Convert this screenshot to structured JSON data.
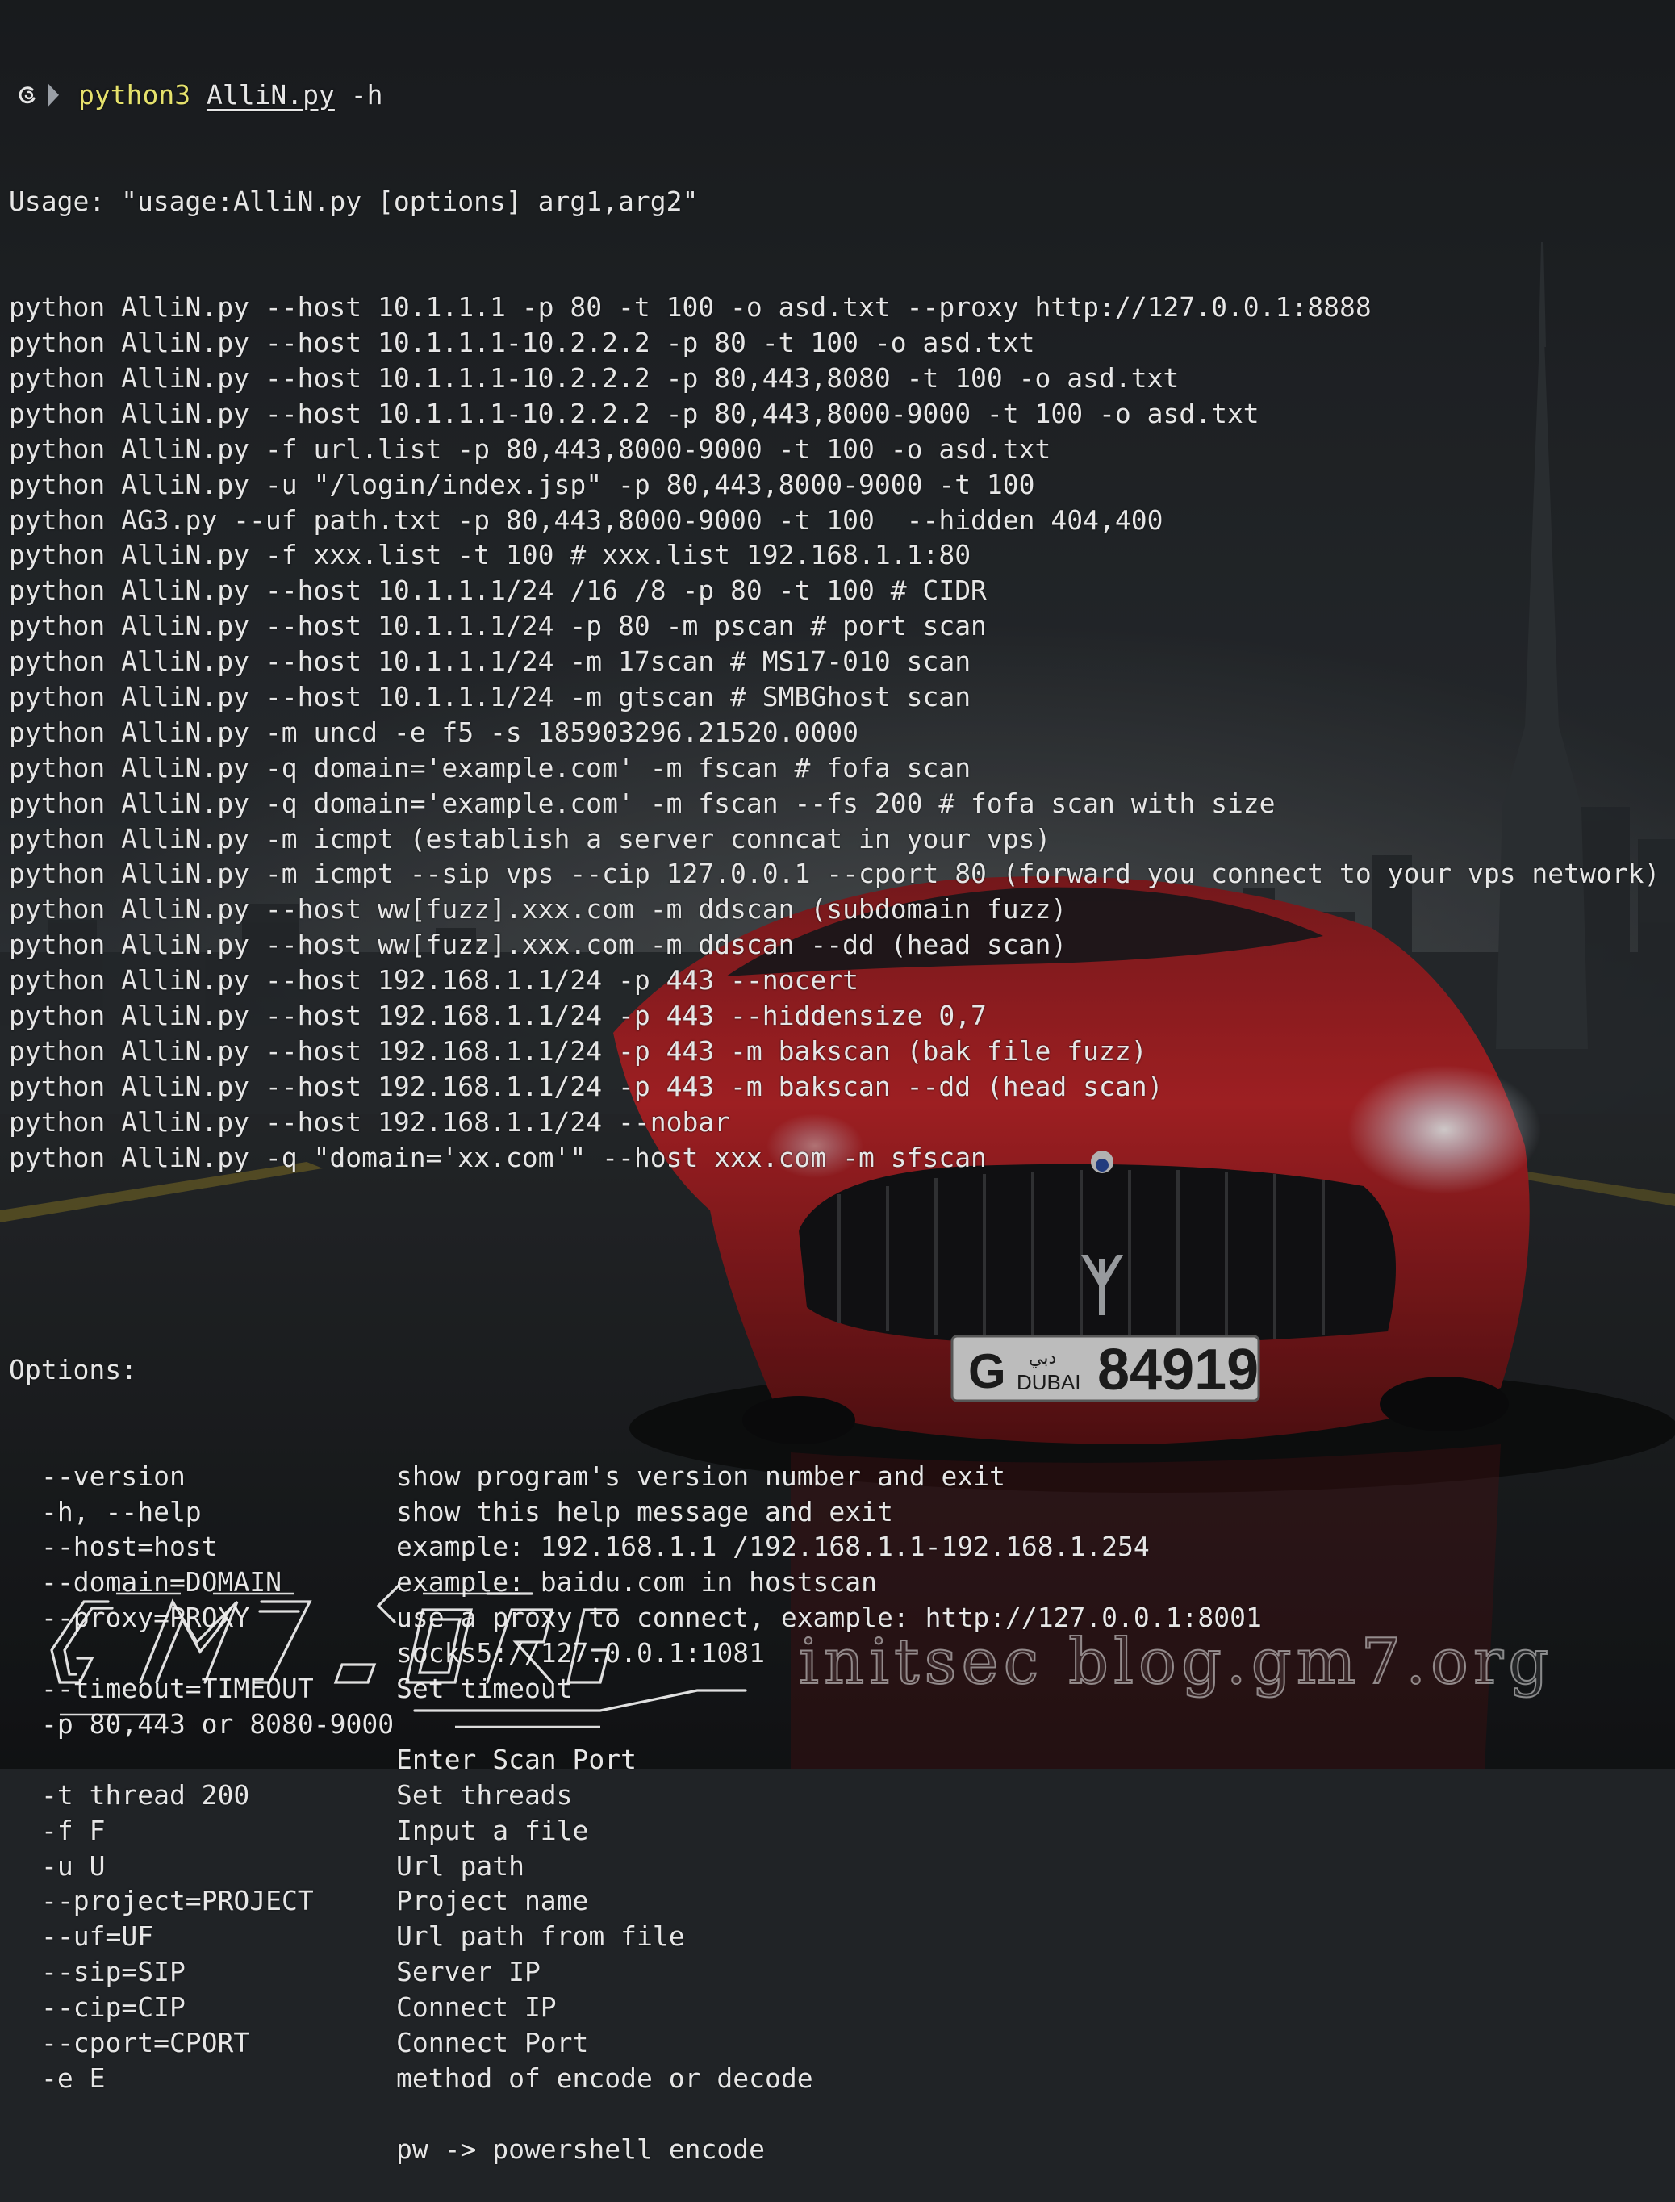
{
  "prompt": {
    "icon": "debian-swirl-icon",
    "command": "python3",
    "script": "AlliN.py",
    "args": "-h"
  },
  "usage_line": "Usage: \"usage:AlliN.py [options] arg1,arg2\"",
  "examples": [
    "python AlliN.py --host 10.1.1.1 -p 80 -t 100 -o asd.txt --proxy http://127.0.0.1:8888",
    "python AlliN.py --host 10.1.1.1-10.2.2.2 -p 80 -t 100 -o asd.txt",
    "python AlliN.py --host 10.1.1.1-10.2.2.2 -p 80,443,8080 -t 100 -o asd.txt",
    "python AlliN.py --host 10.1.1.1-10.2.2.2 -p 80,443,8000-9000 -t 100 -o asd.txt",
    "python AlliN.py -f url.list -p 80,443,8000-9000 -t 100 -o asd.txt",
    "python AlliN.py -u \"/login/index.jsp\" -p 80,443,8000-9000 -t 100",
    "python AG3.py --uf path.txt -p 80,443,8000-9000 -t 100  --hidden 404,400",
    "python AlliN.py -f xxx.list -t 100 # xxx.list 192.168.1.1:80",
    "python AlliN.py --host 10.1.1.1/24 /16 /8 -p 80 -t 100 # CIDR",
    "python AlliN.py --host 10.1.1.1/24 -p 80 -m pscan # port scan",
    "python AlliN.py --host 10.1.1.1/24 -m 17scan # MS17-010 scan",
    "python AlliN.py --host 10.1.1.1/24 -m gtscan # SMBGhost scan",
    "python AlliN.py -m uncd -e f5 -s 185903296.21520.0000",
    "python AlliN.py -q domain='example.com' -m fscan # fofa scan",
    "python AlliN.py -q domain='example.com' -m fscan --fs 200 # fofa scan with size",
    "python AlliN.py -m icmpt (establish a server conncat in your vps)",
    "python AlliN.py -m icmpt --sip vps --cip 127.0.0.1 --cport 80 (forward you connect to your vps network)",
    "python AlliN.py --host ww[fuzz].xxx.com -m ddscan (subdomain fuzz)",
    "python AlliN.py --host ww[fuzz].xxx.com -m ddscan --dd (head scan)",
    "python AlliN.py --host 192.168.1.1/24 -p 443 --nocert",
    "python AlliN.py --host 192.168.1.1/24 -p 443 --hiddensize 0,7",
    "python AlliN.py --host 192.168.1.1/24 -p 443 -m bakscan (bak file fuzz)",
    "python AlliN.py --host 192.168.1.1/24 -p 443 -m bakscan --dd (head scan)",
    "python AlliN.py --host 192.168.1.1/24 --nobar",
    "python AlliN.py -q \"domain='xx.com'\" --host xxx.com -m sfscan"
  ],
  "options_header": "Options:",
  "options": [
    {
      "name": "--version",
      "desc": "show program's version number and exit"
    },
    {
      "name": "-h, --help",
      "desc": "show this help message and exit"
    },
    {
      "name": "--host=host",
      "desc": "example: 192.168.1.1 /192.168.1.1-192.168.1.254"
    },
    {
      "name": "--domain=DOMAIN",
      "desc": "example: baidu.com in hostscan"
    },
    {
      "name": "--proxy=PROXY",
      "desc": "use a proxy to connect, example: http://127.0.0.1:8001"
    },
    {
      "name": "",
      "desc": "socks5://127.0.0.1:1081"
    },
    {
      "name": "--timeout=TIMEOUT",
      "desc": "Set timeout"
    },
    {
      "name": "-p 80,443 or 8080-9000",
      "desc": ""
    },
    {
      "name": "",
      "desc": "Enter Scan Port"
    },
    {
      "name": "-t thread 200",
      "desc": "Set threads"
    },
    {
      "name": "-f F",
      "desc": "Input a file"
    },
    {
      "name": "-u U",
      "desc": "Url path"
    },
    {
      "name": "--project=PROJECT",
      "desc": "Project name"
    },
    {
      "name": "--uf=UF",
      "desc": "Url path from file"
    },
    {
      "name": "--sip=SIP",
      "desc": "Server IP"
    },
    {
      "name": "--cip=CIP",
      "desc": "Connect IP"
    },
    {
      "name": "--cport=CPORT",
      "desc": "Connect Port"
    },
    {
      "name": "-e E",
      "desc": "method of encode or decode"
    },
    {
      "name": "",
      "desc": ""
    },
    {
      "name": "",
      "desc": "pw -> powershell encode"
    }
  ],
  "watermark": "initsec blog.gm7.org",
  "colors": {
    "command": "#e5e16c",
    "text": "#e6e6e6",
    "car": "#c0262a",
    "plate": "#e6e6e6"
  },
  "plate": {
    "letter": "G",
    "arabic": "دبي",
    "city": "DUBAI",
    "number": "84919"
  }
}
